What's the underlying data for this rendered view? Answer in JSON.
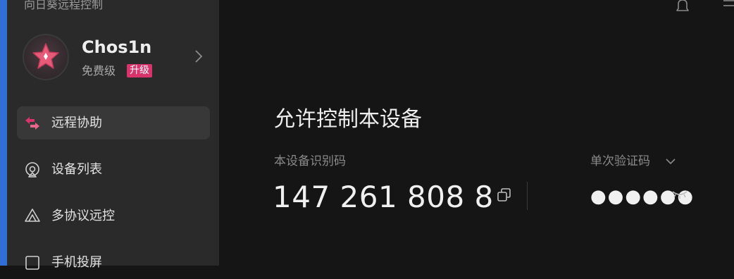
{
  "app": {
    "title": "向日葵远程控制"
  },
  "profile": {
    "username": "Chos1n",
    "tier": "免费级",
    "upgrade_label": "升级"
  },
  "sidebar": {
    "items": [
      {
        "label": "远程协助",
        "icon": "remote-assist-icon",
        "active": true
      },
      {
        "label": "设备列表",
        "icon": "device-list-icon",
        "active": false
      },
      {
        "label": "多协议远控",
        "icon": "multi-protocol-icon",
        "active": false
      },
      {
        "label": "手机投屏",
        "icon": "phone-mirror-icon",
        "active": false
      }
    ]
  },
  "main": {
    "section_title": "允许控制本设备",
    "device_id_label": "本设备识别码",
    "device_id": "147 261 808 8",
    "code_label": "单次验证码",
    "code_value": "●●●●●●"
  },
  "colors": {
    "accent_blue": "#2f6fd6",
    "brand_pink": "#d8336a",
    "sidebar_bg": "#2a2a2a",
    "main_bg": "#151515"
  }
}
